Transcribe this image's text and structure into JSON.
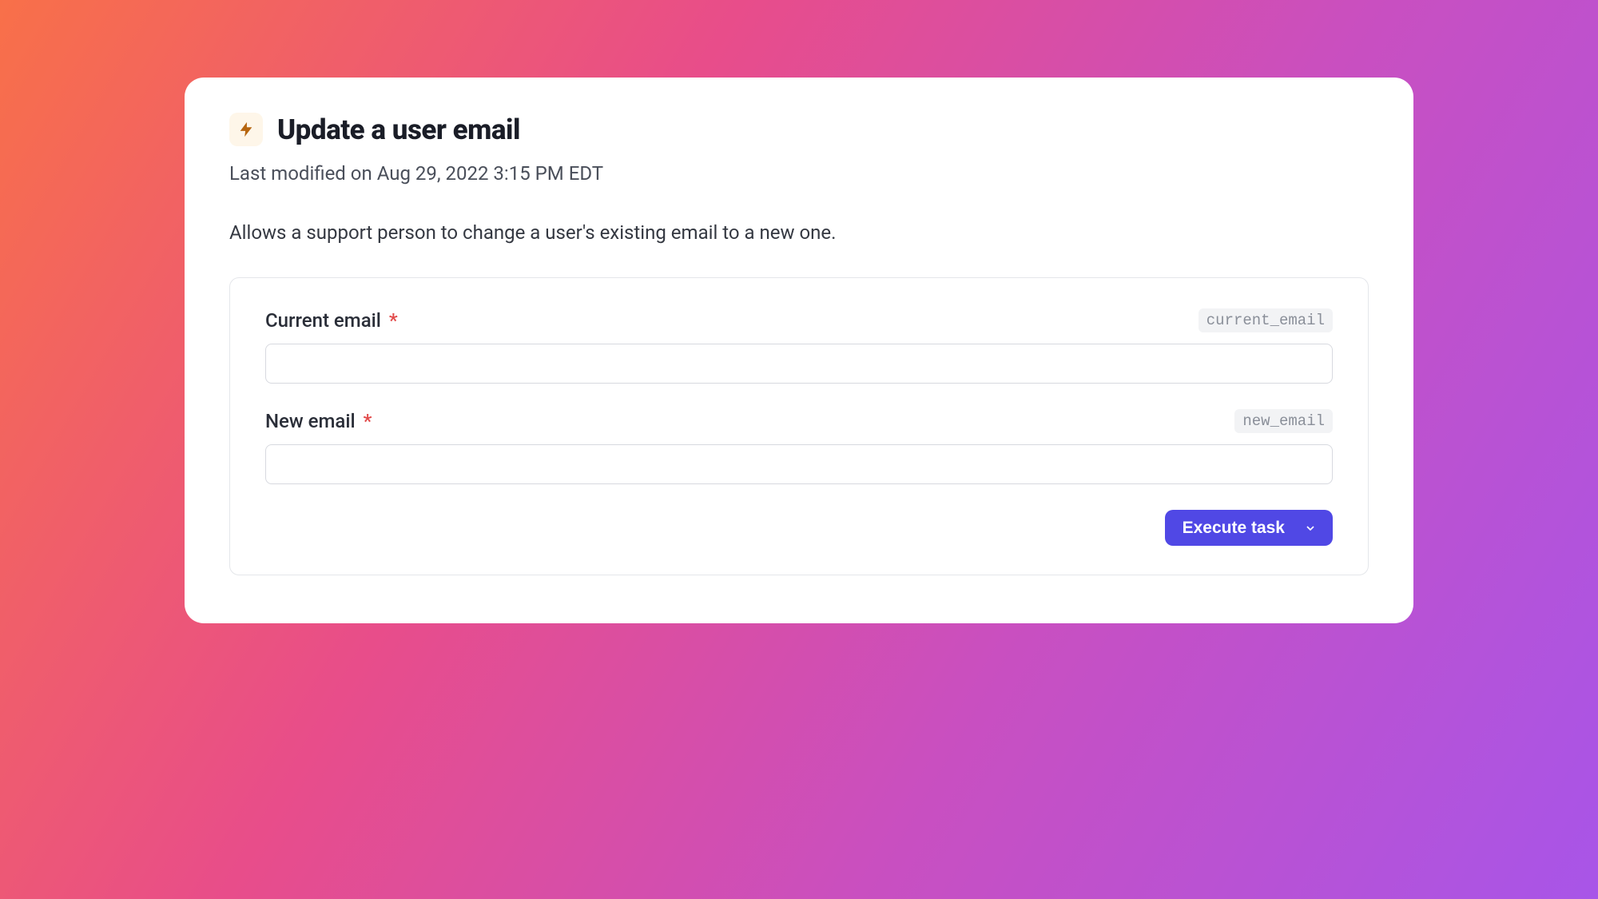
{
  "header": {
    "title": "Update a user email",
    "last_modified": "Last modified on Aug 29, 2022 3:15 PM EDT",
    "description": "Allows a support person to change a user's existing email to a new one."
  },
  "form": {
    "fields": [
      {
        "label": "Current email",
        "required": "*",
        "param": "current_email",
        "value": ""
      },
      {
        "label": "New email",
        "required": "*",
        "param": "new_email",
        "value": ""
      }
    ],
    "submit_label": "Execute task"
  }
}
